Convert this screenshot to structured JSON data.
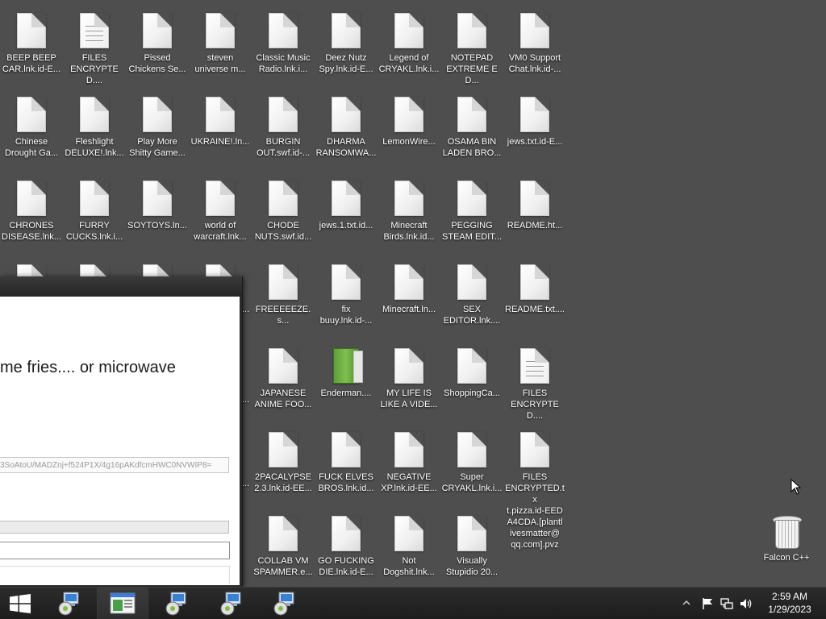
{
  "desktop": {
    "icons": [
      {
        "label": "BEEP BEEP\nCAR.lnk.id-E...",
        "style": "doc"
      },
      {
        "label": "FILES\nENCRYPTED....",
        "style": "lined"
      },
      {
        "label": "Pissed\nChickens Se...",
        "style": "doc"
      },
      {
        "label": "steven\nuniverse m...",
        "style": "doc"
      },
      {
        "label": "Classic Music\nRadio.lnk.i...",
        "style": "doc"
      },
      {
        "label": "Deez Nutz\nSpy.lnk.id-E...",
        "style": "doc"
      },
      {
        "label": "Legend of\nCRYAKL.lnk.i...",
        "style": "doc"
      },
      {
        "label": "NOTEPAD\nEXTREME ED...",
        "style": "doc"
      },
      {
        "label": "VM0 Support\nChat.lnk.id-...",
        "style": "doc"
      },
      {
        "label": "Chinese\nDrought Ga...",
        "style": "doc"
      },
      {
        "label": "Fleshlight\nDELUXE!.lnk...",
        "style": "doc"
      },
      {
        "label": "Play More\nShitty Game...",
        "style": "doc"
      },
      {
        "label": "UKRAINE!.ln...",
        "style": "doc"
      },
      {
        "label": "BURGIN\nOUT.swf.id-...",
        "style": "doc"
      },
      {
        "label": "DHARMA\nRANSOMWA...",
        "style": "doc"
      },
      {
        "label": "LemonWire...",
        "style": "doc"
      },
      {
        "label": "OSAMA BIN\nLADEN BRO...",
        "style": "doc"
      },
      {
        "label": "jews.txt.id-E...",
        "style": "doc"
      },
      {
        "label": "CHRONES\nDISEASE.lnk...",
        "style": "doc"
      },
      {
        "label": "FURRY\nCUCKS.lnk.i...",
        "style": "doc"
      },
      {
        "label": "SOYTOYS.ln...",
        "style": "doc"
      },
      {
        "label": "world of\nwarcraft.lnk...",
        "style": "doc"
      },
      {
        "label": "CHODE\nNUTS.swf.id...",
        "style": "doc"
      },
      {
        "label": "jews.1.txt.id...",
        "style": "doc"
      },
      {
        "label": "Minecraft\nBirds.lnk.id...",
        "style": "doc"
      },
      {
        "label": "PEGGING\nSTEAM EDIT...",
        "style": "doc"
      },
      {
        "label": "README.ht...",
        "style": "doc"
      },
      {
        "label": "FREEEEEZE.s...",
        "style": "doc"
      },
      {
        "label": "fix\nbuuy.lnk.id-...",
        "style": "doc"
      },
      {
        "label": "Minecraft.ln...",
        "style": "doc"
      },
      {
        "label": "SEX\nEDITOR.lnk....",
        "style": "doc"
      },
      {
        "label": "README.txt....",
        "style": "doc"
      },
      {
        "label": "JAPANESE\nANIME FOO...",
        "style": "doc"
      },
      {
        "label": "Enderman....",
        "style": "green"
      },
      {
        "label": "MY LIFE IS\nLIKE A VIDE...",
        "style": "doc"
      },
      {
        "label": "ShoppingCa...",
        "style": "doc"
      },
      {
        "label": "FILES\nENCRYPTED....",
        "style": "lined"
      },
      {
        "label": "2PACALYPSE\n2.3.lnk.id-EE...",
        "style": "doc"
      },
      {
        "label": "FUCK ELVES\nBROS.lnk.id...",
        "style": "doc"
      },
      {
        "label": "NEGATIVE\nXP.lnk.id-EE...",
        "style": "doc"
      },
      {
        "label": "Super\nCRYAKL.lnk.i...",
        "style": "doc"
      },
      {
        "label": "FILES\nENCRYPTED.tx\nt.pizza.id-EED\nA4CDA.[plantl\nivesmatter@\nqq.com].pvz",
        "style": "doc"
      },
      {
        "label": "COLLAB VM\nSPAMMER.e...",
        "style": "doc"
      },
      {
        "label": "GO FUCKING\nDIE.lnk.id-E...",
        "style": "doc"
      },
      {
        "label": "Not\nDogshit.lnk...",
        "style": "doc"
      },
      {
        "label": "Visually\nStupidio 20...",
        "style": "doc"
      }
    ],
    "partial_labels": [
      {
        "text": "..."
      },
      {
        "text": "..."
      },
      {
        "text": "ic"
      },
      {
        "text": "..."
      }
    ],
    "recycle_bin": {
      "label": "Falcon C++"
    }
  },
  "window": {
    "message": "me fries.... or microwave",
    "key_text": "3SoAtoU/MADZnj+f524P1X/4g16pAKdfcmHWC0NVWIP8="
  },
  "taskbar": {
    "clock_time": "2:59 AM",
    "clock_date": "1/29/2023"
  },
  "colors": {
    "desktop_bg": "#4e4e4e",
    "taskbar_bg": "#1d1d1d"
  }
}
